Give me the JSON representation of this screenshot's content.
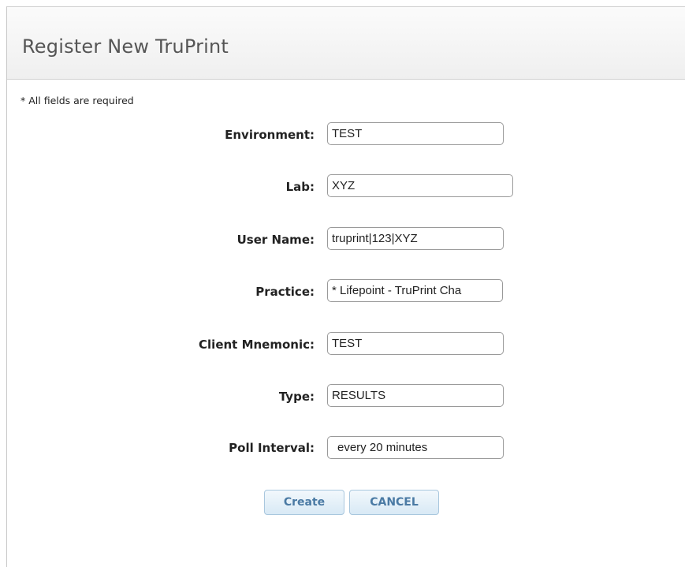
{
  "dialog": {
    "title": "Register New TruPrint",
    "required_note": "* All fields are required"
  },
  "form": {
    "environment": {
      "label": "Environment:",
      "value": "TEST"
    },
    "lab": {
      "label": "Lab:",
      "value": "XYZ"
    },
    "user_name": {
      "label": "User Name:",
      "value": "truprint|123|XYZ"
    },
    "practice": {
      "label": "Practice:",
      "value": "* Lifepoint - TruPrint Cha"
    },
    "client_mnemonic": {
      "label": "Client Mnemonic:",
      "value": "TEST"
    },
    "type": {
      "label": "Type:",
      "value": "RESULTS"
    },
    "poll_interval": {
      "label": "Poll Interval:",
      "value": "every 20 minutes"
    }
  },
  "buttons": {
    "create_label": "Create",
    "cancel_label": "CANCEL"
  }
}
